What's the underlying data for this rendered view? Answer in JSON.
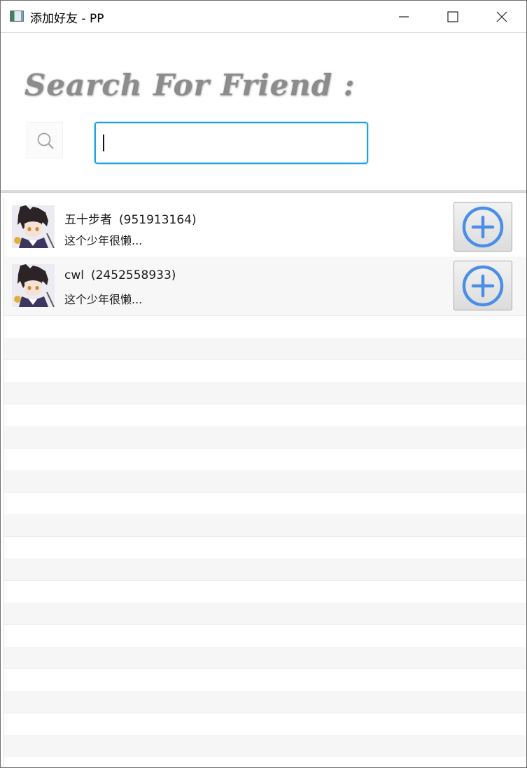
{
  "window": {
    "title": "添加好友 - PP",
    "icon": "app-window-icon"
  },
  "titlebar_controls": {
    "minimize_icon": "minimize-icon",
    "maximize_icon": "maximize-icon",
    "close_icon": "close-icon"
  },
  "search": {
    "heading": "Search For Friend :",
    "icon": "search-icon",
    "input_value": "",
    "input_placeholder": ""
  },
  "results": [
    {
      "name": "五十步者",
      "qq": "(951913164)",
      "signature": "这个少年很懒...",
      "avatar_icon": "anime-avatar-icon",
      "add_icon": "plus-circle-icon"
    },
    {
      "name": "cwl",
      "qq": "(2452558933)",
      "signature": "这个少年很懒...",
      "avatar_icon": "anime-avatar-icon",
      "add_icon": "plus-circle-icon"
    }
  ],
  "colors": {
    "accent_blue": "#4a8ee8",
    "input_focus_border": "#1aa3e3",
    "heading_gray": "#8c8c8c"
  }
}
